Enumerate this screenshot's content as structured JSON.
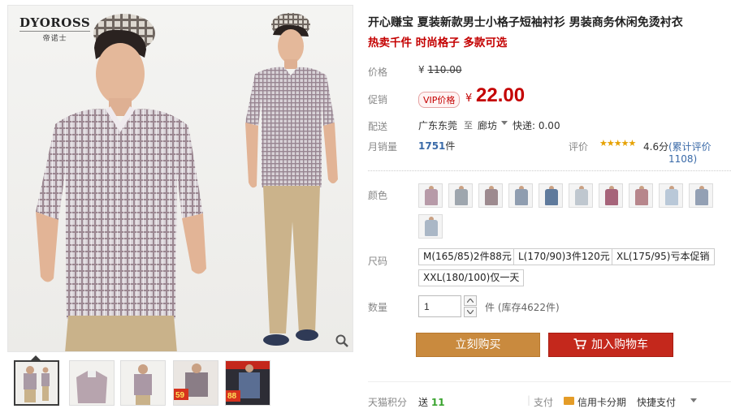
{
  "brand": {
    "name": "DYOROSS",
    "sub": "帝诺士"
  },
  "product": {
    "title": "开心赚宝 夏装新款男士小格子短袖衬衫 男装商务休闲免烫衬衣",
    "subtitle": "热卖千件 时尚格子 多款可选"
  },
  "price": {
    "label": "价格",
    "currency": "¥",
    "original": "110.00",
    "promo_label": "促销",
    "vip_badge": "VIP价格",
    "promo": "22.00"
  },
  "shipping": {
    "label": "配送",
    "from": "广东东莞",
    "to_icon": "至",
    "to": "廊坊",
    "fee": "快递: 0.00"
  },
  "sales": {
    "label": "月销量",
    "count": "1751",
    "unit": "件",
    "rating_label": "评价",
    "stars": "★★★★★",
    "score": "4.6分",
    "total": "(累计评价1108)"
  },
  "options": {
    "color_label": "颜色",
    "colors": [
      "#b79aa8",
      "#9ea6ae",
      "#9d8a8f",
      "#8f9db0",
      "#5f7a9c",
      "#bfc7cf",
      "#a6647a",
      "#b7868c",
      "#b9c8d8",
      "#93a0b4",
      "#aab7c6"
    ],
    "size_label": "尺码",
    "sizes": [
      "M(165/85)2件88元",
      "L(170/90)3件120元",
      "XL(175/95)亏本促销",
      "XXL(180/100)仅一天"
    ]
  },
  "quantity": {
    "label": "数量",
    "value": "1",
    "unit": "件 (库存4622件)"
  },
  "actions": {
    "buy": "立刻购买",
    "cart": "加入购物车"
  },
  "footer": {
    "points_label": "天猫积分",
    "points_prefix": "送",
    "points_value": "11",
    "pay_label": "支付",
    "card_pay": "信用卡分期",
    "quick_pay": "快捷支付"
  },
  "thumbnails": [
    {
      "label": ""
    },
    {
      "label": ""
    },
    {
      "label": ""
    },
    {
      "label": "59"
    },
    {
      "label": "88"
    }
  ]
}
